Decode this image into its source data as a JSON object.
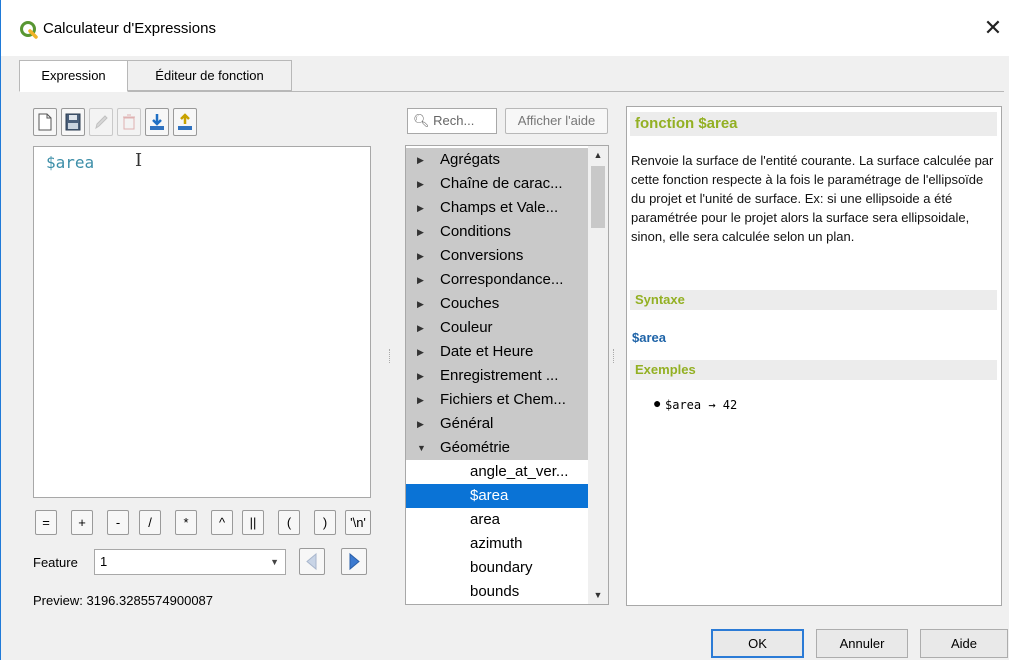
{
  "window": {
    "title": "Calculateur d'Expressions"
  },
  "tabs": [
    {
      "label": "Expression",
      "active": true
    },
    {
      "label": "Éditeur de fonction",
      "active": false
    }
  ],
  "toolbar": {
    "icons": [
      "new-file-icon",
      "save-icon",
      "edit-icon",
      "delete-icon",
      "import-icon",
      "export-icon"
    ]
  },
  "editor": {
    "text": "$area"
  },
  "operators": [
    "=",
    "+",
    "-",
    "/",
    "*",
    "^",
    "||",
    "(",
    ")",
    "'\\n'"
  ],
  "feature": {
    "label": "Feature",
    "value": "1"
  },
  "preview": {
    "label": "Preview:",
    "value": "3196.3285574900087"
  },
  "search": {
    "placeholder": "Rech..."
  },
  "help_button": "Afficher l'aide",
  "tree": {
    "categories": [
      "Agrégats",
      "Chaîne de carac...",
      "Champs et Vale...",
      "Conditions",
      "Conversions",
      "Correspondance...",
      "Couches",
      "Couleur",
      "Date et Heure",
      "Enregistrement ...",
      "Fichiers et Chem...",
      "Général",
      "Géométrie"
    ],
    "expanded": "Géométrie",
    "children": [
      "angle_at_ver...",
      "$area",
      "area",
      "azimuth",
      "boundary",
      "bounds"
    ],
    "selected": "$area"
  },
  "help": {
    "title": "fonction $area",
    "description": "Renvoie la surface de l'entité courante. La surface calculée par cette fonction respecte à la fois le paramétrage de l'ellipsoïde du projet et l'unité de surface. Ex: si une ellipsoide a été paramétrée pour le projet alors la surface sera ellipsoidale, sinon, elle sera calculée selon un plan.",
    "syntax_header": "Syntaxe",
    "syntax": "$area",
    "examples_header": "Exemples",
    "example": "$area → 42"
  },
  "buttons": {
    "ok": "OK",
    "cancel": "Annuler",
    "help": "Aide"
  },
  "colors": {
    "accent": "#0a73d6",
    "help_title": "#93b023",
    "syntax": "#1f64a8"
  }
}
